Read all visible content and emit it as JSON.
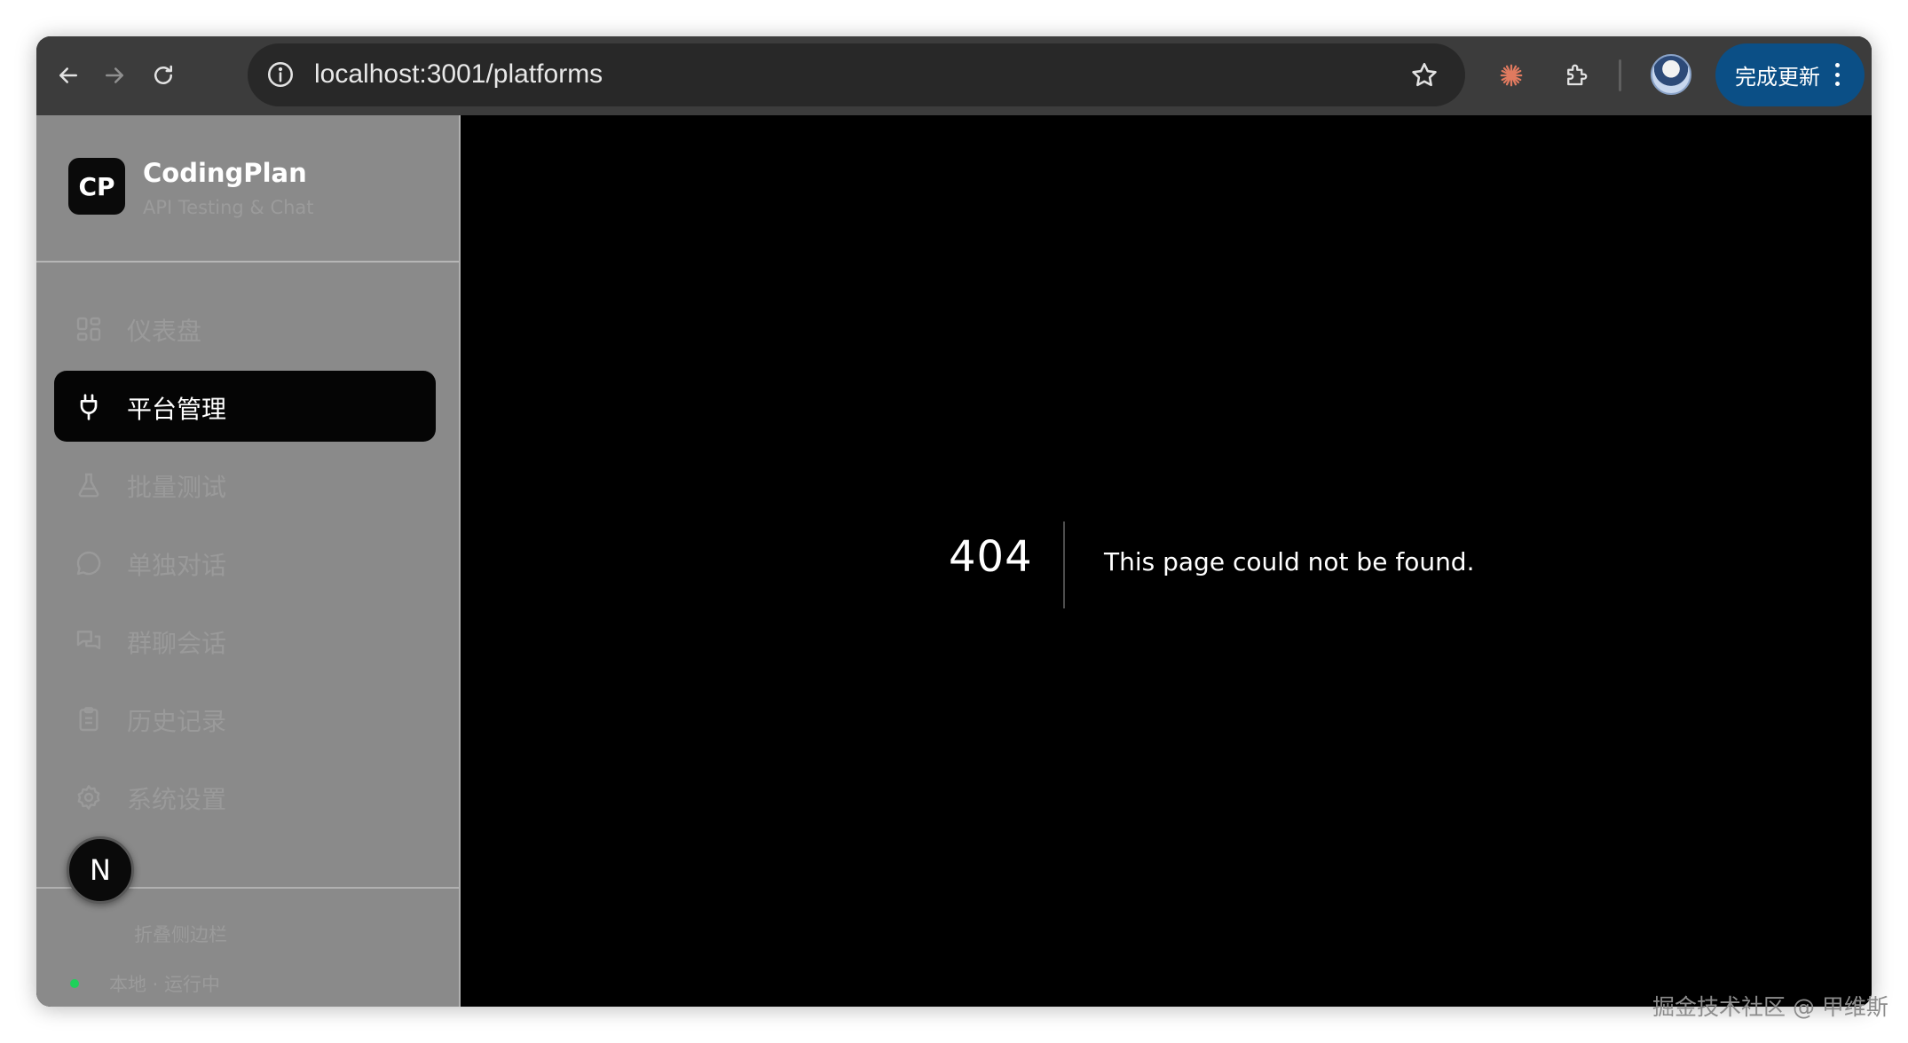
{
  "browser": {
    "url": "localhost:3001/platforms",
    "update_button_label": "完成更新",
    "icons": {
      "back": "arrow-left",
      "forward": "arrow-right",
      "reload": "reload",
      "site_info": "info-circle",
      "bookmark": "star-outline",
      "claude_extension": "sunburst",
      "extensions": "puzzle",
      "profile": "avatar",
      "menu": "vertical-dots"
    },
    "update_color": "#0b4f86"
  },
  "sidebar": {
    "logo_text": "CP",
    "app_name": "CodingPlan",
    "app_subtitle": "API Testing & Chat",
    "items": [
      {
        "label": "仪表盘",
        "icon": "dashboard-grid",
        "active": false
      },
      {
        "label": "平台管理",
        "icon": "plug",
        "active": true
      },
      {
        "label": "批量测试",
        "icon": "flask",
        "active": false
      },
      {
        "label": "单独对话",
        "icon": "chat-bubble",
        "active": false
      },
      {
        "label": "群聊会话",
        "icon": "chat-bubbles",
        "active": false
      },
      {
        "label": "历史记录",
        "icon": "clipboard",
        "active": false
      },
      {
        "label": "系统设置",
        "icon": "gear",
        "active": false
      }
    ],
    "footer_line1": "折叠侧边栏",
    "footer_line2": "本地 · 运行中",
    "next_badge": "N"
  },
  "error": {
    "code": "404",
    "message": "This page could not be found."
  },
  "watermark": "掘金技术社区 @ 甲维斯"
}
